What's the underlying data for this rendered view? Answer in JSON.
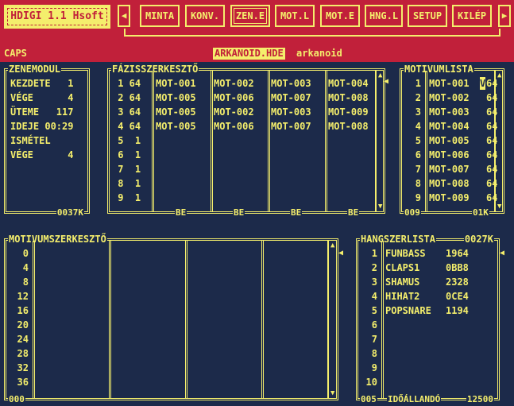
{
  "header": {
    "app_title": "HDIGI 1.1 Hsoft",
    "left_arrow": "◀",
    "right_arrow": "▶",
    "menu": [
      "MINTA",
      "KONV.",
      "ZEN.E",
      "MOT.L",
      "MOT.E",
      "HNG.L",
      "SETUP",
      "KILÉP"
    ],
    "caps": "CAPS",
    "filename": "ARKANOID.HDE",
    "file_desc": "arkanoid"
  },
  "zenemodul": {
    "title": "ZENEMODUL",
    "rows": [
      "KEZDETE   1",
      "VÉGE      4",
      "ÜTEME   117",
      "IDEJE 00:29",
      "ISMÉTEL",
      "VÉGE      4"
    ],
    "footer": "0037K"
  },
  "fazis": {
    "title": "FÁZISSZERKESZTŐ",
    "nums": [
      " 1 64",
      " 2 64",
      " 3 64",
      " 4 64",
      " 5  1",
      " 6  1",
      " 7  1",
      " 8  1",
      " 9  1"
    ],
    "columns": [
      [
        "MOT-001",
        "MOT-005",
        "MOT-005",
        "MOT-005"
      ],
      [
        "MOT-002",
        "MOT-006",
        "MOT-002",
        "MOT-006"
      ],
      [
        "MOT-003",
        "MOT-007",
        "MOT-003",
        "MOT-007"
      ],
      [
        "MOT-004",
        "MOT-008",
        "MOT-009",
        "MOT-008"
      ]
    ],
    "col_footer": "BE",
    "scroll_up": "▲",
    "scroll_down": "▼",
    "side_arrow": "◀"
  },
  "motivumlista": {
    "title": "MOTIVUMLISTA",
    "rows": [
      {
        "n": "1",
        "name": "MOT-001",
        "v": "64"
      },
      {
        "n": "2",
        "name": "MOT-002",
        "v": "64"
      },
      {
        "n": "3",
        "name": "MOT-003",
        "v": "64"
      },
      {
        "n": "4",
        "name": "MOT-004",
        "v": "64"
      },
      {
        "n": "5",
        "name": "MOT-005",
        "v": "64"
      },
      {
        "n": "6",
        "name": "MOT-006",
        "v": "64"
      },
      {
        "n": "7",
        "name": "MOT-007",
        "v": "64"
      },
      {
        "n": "8",
        "name": "MOT-008",
        "v": "64"
      },
      {
        "n": "9",
        "name": "MOT-009",
        "v": "64"
      }
    ],
    "marker": "V",
    "footer_left": "009",
    "footer_right": "01K"
  },
  "motivumszerkeszto": {
    "title": "MOTIVUMSZERKESZTŐ",
    "rows": [
      "0",
      "4",
      "8",
      "12",
      "16",
      "20",
      "24",
      "28",
      "32",
      "36"
    ],
    "footer": "000"
  },
  "hangszerlista": {
    "title": "HANGSZERLISTA",
    "title_right": "0027K",
    "rows": [
      {
        "n": "1",
        "name": "FUNBASS",
        "v": "1964"
      },
      {
        "n": "2",
        "name": "CLAPS1",
        "v": "0BB8"
      },
      {
        "n": "3",
        "name": "SHAMUS",
        "v": "2328"
      },
      {
        "n": "4",
        "name": "HIHAT2",
        "v": "0CE4"
      },
      {
        "n": "5",
        "name": "POPSNARE",
        "v": "1194"
      },
      {
        "n": "6",
        "name": "",
        "v": ""
      },
      {
        "n": "7",
        "name": "",
        "v": ""
      },
      {
        "n": "8",
        "name": "",
        "v": ""
      },
      {
        "n": "9",
        "name": "",
        "v": ""
      },
      {
        "n": "10",
        "name": "",
        "v": ""
      }
    ],
    "footer_left": "005",
    "footer_mid": "IDŐÁLLANDÓ",
    "footer_right": "12500"
  }
}
